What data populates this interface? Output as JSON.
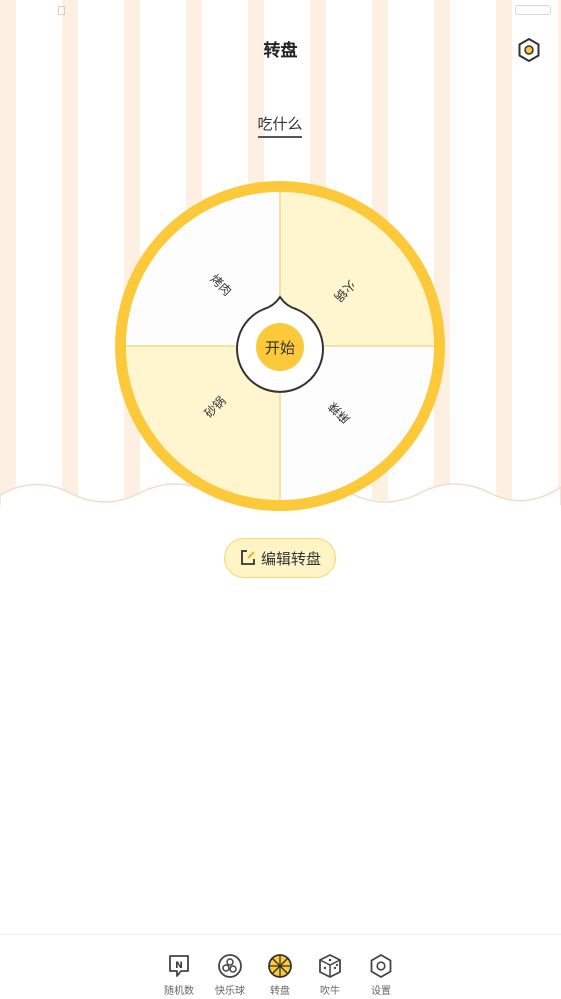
{
  "header": {
    "title": "转盘"
  },
  "subtitle": "吃什么",
  "wheel": {
    "start_label": "开始",
    "segments": [
      "烤肉",
      "火锅",
      "砂锅",
      "麻辣"
    ],
    "colors": {
      "ring": "#fbc93a",
      "light": "#fff6cf",
      "white": "#fdfdfd",
      "center": "#fbc93a"
    }
  },
  "edit_button": {
    "label": "编辑转盘"
  },
  "nav": {
    "items": [
      {
        "label": "随机数",
        "icon": "n-badge-icon"
      },
      {
        "label": "快乐球",
        "icon": "balls-icon"
      },
      {
        "label": "转盘",
        "icon": "wheel-icon"
      },
      {
        "label": "吹牛",
        "icon": "dice-icon"
      },
      {
        "label": "设置",
        "icon": "hexagon-settings-icon"
      }
    ]
  },
  "colors": {
    "stripe": "#fdf0e3",
    "accent": "#fbc93a"
  }
}
